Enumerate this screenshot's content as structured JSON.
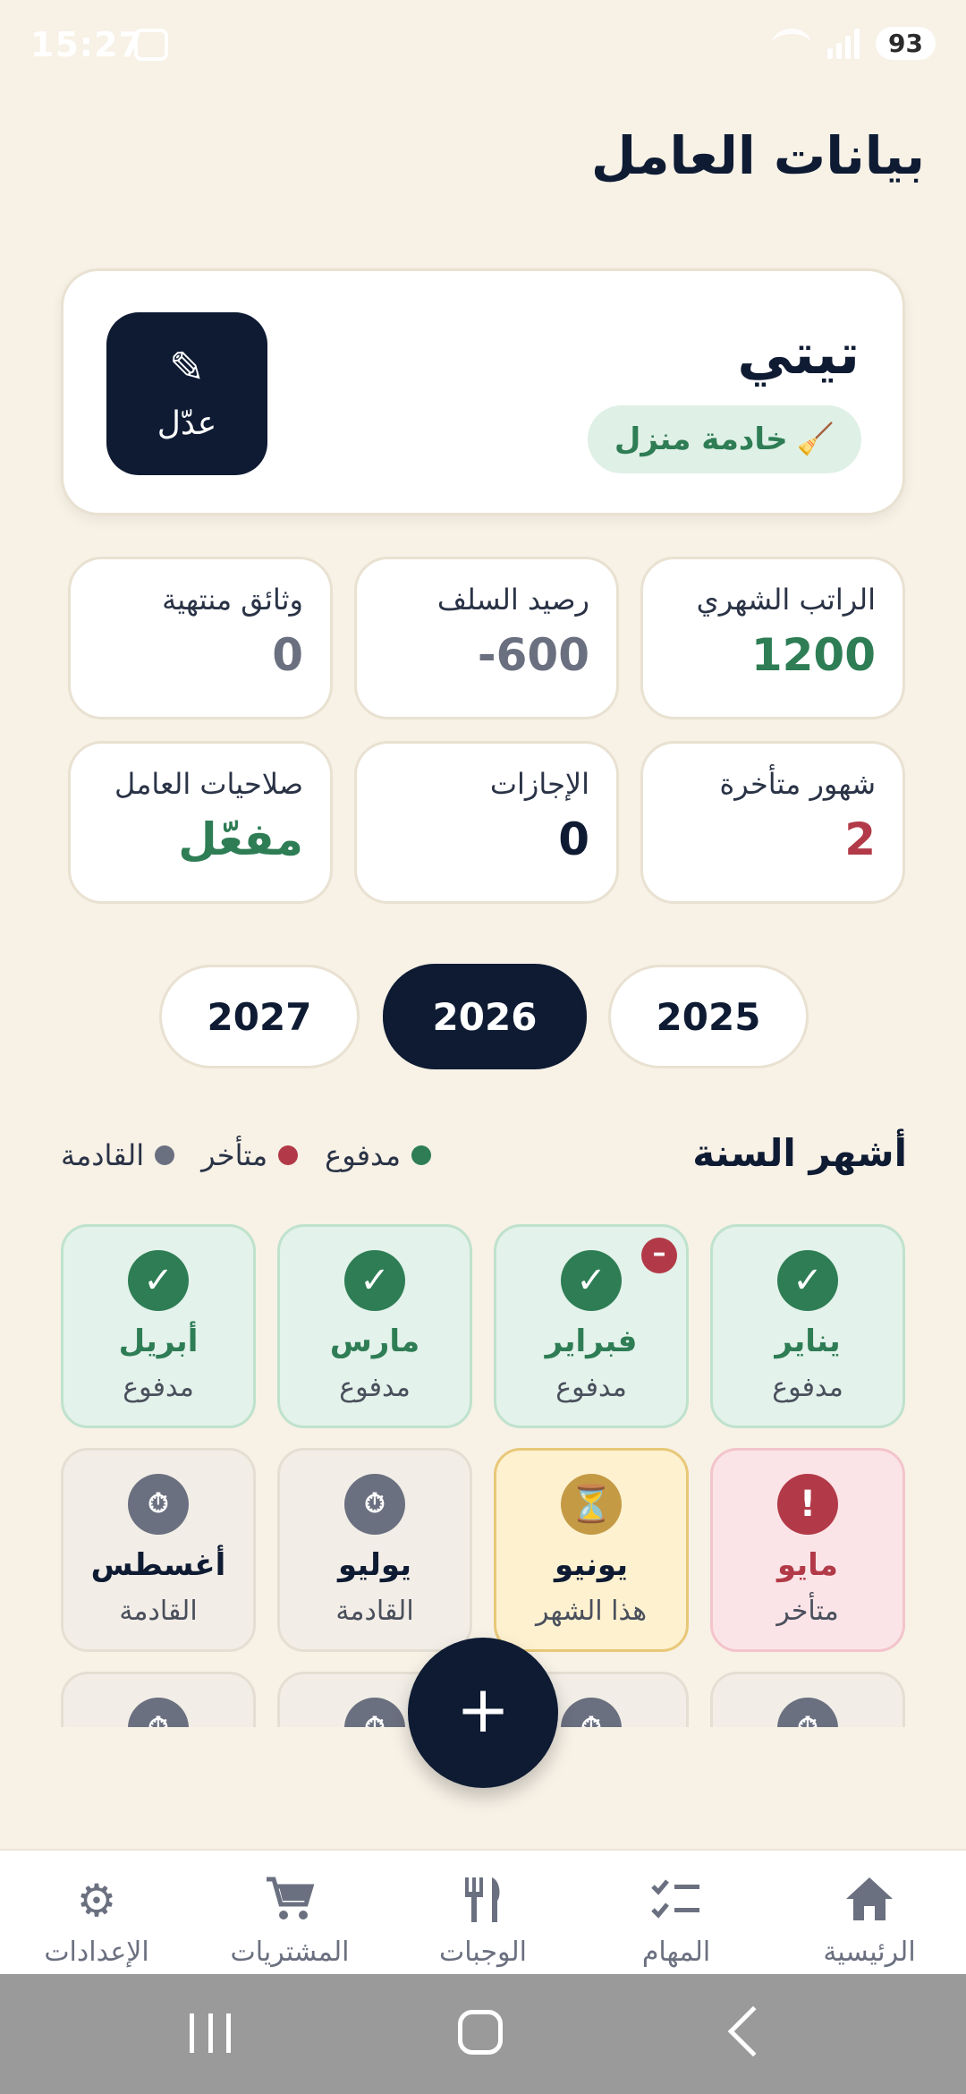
{
  "status": {
    "time": "15:27",
    "battery": "93"
  },
  "page_title": "بيانات العامل",
  "profile": {
    "name": "تيتي",
    "role": "خادمة منزل",
    "edit_label": "عدّل"
  },
  "stats": [
    {
      "label": "الراتب الشهري",
      "value": "1200"
    },
    {
      "label": "رصيد السلف",
      "value": "600-"
    },
    {
      "label": "وثائق منتهية",
      "value": "0"
    },
    {
      "label": "شهور متأخرة",
      "value": "2"
    },
    {
      "label": "الإجازات",
      "value": "0"
    },
    {
      "label": "صلاحيات العامل",
      "value": "مفعّل"
    }
  ],
  "years": [
    "2025",
    "2026",
    "2027"
  ],
  "selected_year": "2026",
  "months_section": {
    "title": "أشهر السنة",
    "legend": {
      "paid": "مدفوع",
      "late": "متأخر",
      "upcoming": "القادمة"
    },
    "months": [
      {
        "name": "يناير",
        "status": "مدفوع"
      },
      {
        "name": "فبراير",
        "status": "مدفوع"
      },
      {
        "name": "مارس",
        "status": "مدفوع"
      },
      {
        "name": "أبريل",
        "status": "مدفوع"
      },
      {
        "name": "مايو",
        "status": "متأخر"
      },
      {
        "name": "يونيو",
        "status": "هذا الشهر"
      },
      {
        "name": "يوليو",
        "status": "القادمة"
      },
      {
        "name": "أغسطس",
        "status": "القادمة"
      }
    ]
  },
  "fab_label": "+",
  "colors": {
    "background": "#f7f1e6",
    "primary": "#0e1b33",
    "paid": "#2e7d55",
    "late": "#b23a48",
    "current": "#c49a45",
    "upcoming": "#6b7080"
  },
  "nav": [
    {
      "label": "الرئيسية",
      "icon": "home-icon"
    },
    {
      "label": "المهام",
      "icon": "tasks-icon"
    },
    {
      "label": "الوجبات",
      "icon": "utensils-icon"
    },
    {
      "label": "المشتريات",
      "icon": "cart-icon"
    },
    {
      "label": "الإعدادات",
      "icon": "gear-icon"
    }
  ]
}
